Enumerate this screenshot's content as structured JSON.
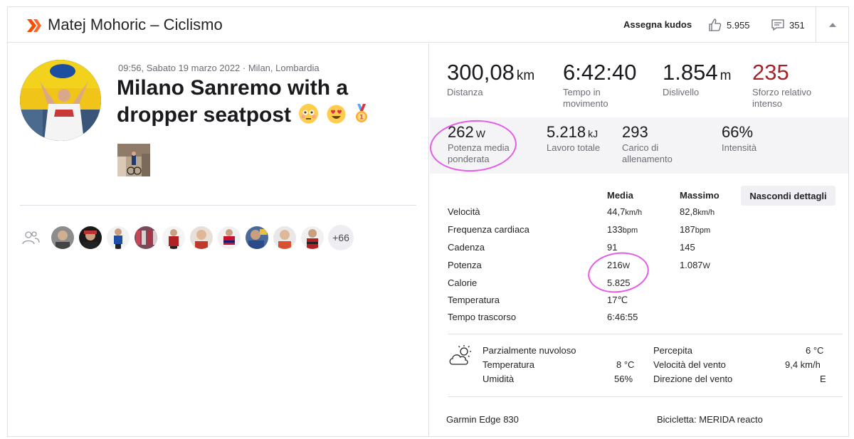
{
  "header": {
    "title": "Matej Mohoric – Ciclismo",
    "give_kudos_label": "Assegna kudos",
    "kudos_count": "5.955",
    "comments_count": "351",
    "icons": {
      "logo": "strava-chevrons-icon",
      "kudos": "thumbs-up-icon",
      "comments": "comment-icon",
      "collapse": "caret-up-icon"
    },
    "accent_color": "#fc4c02"
  },
  "activity": {
    "meta": "09:56, Sabato 19 marzo 2022 · Milan, Lombardia",
    "title": "Milano Sanremo with a dropper seatpost",
    "title_emojis": [
      "flushed-face",
      "heart-eyes-face",
      "1st-place-medal"
    ],
    "more_athletes": "+66"
  },
  "stats": {
    "distance": {
      "value": "300,08",
      "unit": "km",
      "label": "Distanza"
    },
    "moving_time": {
      "value": "6:42:40",
      "label": "Tempo in movimento"
    },
    "elevation": {
      "value": "1.854",
      "unit": "m",
      "label": "Dislivello"
    },
    "relative_effort": {
      "value": "235",
      "label": "Sforzo relativo intenso",
      "color": "#a5232a"
    }
  },
  "power_band": {
    "weighted_power": {
      "value": "262",
      "unit": "W",
      "label": "Potenza media ponderata"
    },
    "total_work": {
      "value": "5.218",
      "unit": "kJ",
      "label": "Lavoro totale"
    },
    "training_load": {
      "value": "293",
      "label": "Carico di allenamento"
    },
    "intensity": {
      "value": "66%",
      "label": "Intensità"
    }
  },
  "details": {
    "col_avg": "Media",
    "col_max": "Massimo",
    "hide_button": "Nascondi dettagli",
    "rows": [
      {
        "name": "Velocità",
        "avg": "44,7",
        "avg_unit": "km/h",
        "max": "82,8",
        "max_unit": "km/h"
      },
      {
        "name": "Frequenza cardiaca",
        "avg": "133",
        "avg_unit": "bpm",
        "max": "187",
        "max_unit": "bpm"
      },
      {
        "name": "Cadenza",
        "avg": "91",
        "avg_unit": "",
        "max": "145",
        "max_unit": ""
      },
      {
        "name": "Potenza",
        "avg": "216",
        "avg_unit": "W",
        "max": "1.087",
        "max_unit": "W"
      },
      {
        "name": "Calorie",
        "avg": "5.825",
        "avg_unit": "",
        "max": "",
        "max_unit": ""
      },
      {
        "name": "Temperatura",
        "avg": "17℃",
        "avg_unit": "",
        "max": "",
        "max_unit": ""
      },
      {
        "name": "Tempo trascorso",
        "avg": "6:46:55",
        "avg_unit": "",
        "max": "",
        "max_unit": ""
      }
    ]
  },
  "weather": {
    "icon": "partly-cloudy-icon",
    "condition": "Parzialmente nuvoloso",
    "temp_label": "Temperatura",
    "temp_value": "8 °C",
    "humidity_label": "Umidità",
    "humidity_value": "56%",
    "feels_label": "Percepita",
    "feels_value": "6 °C",
    "wind_speed_label": "Velocità del vento",
    "wind_speed_value": "9,4 km/h",
    "wind_dir_label": "Direzione del vento",
    "wind_dir_value": "E"
  },
  "footer": {
    "device": "Garmin Edge 830",
    "bike": "Bicicletta: MERIDA reacto"
  },
  "annotation_color": "#e45ce6"
}
